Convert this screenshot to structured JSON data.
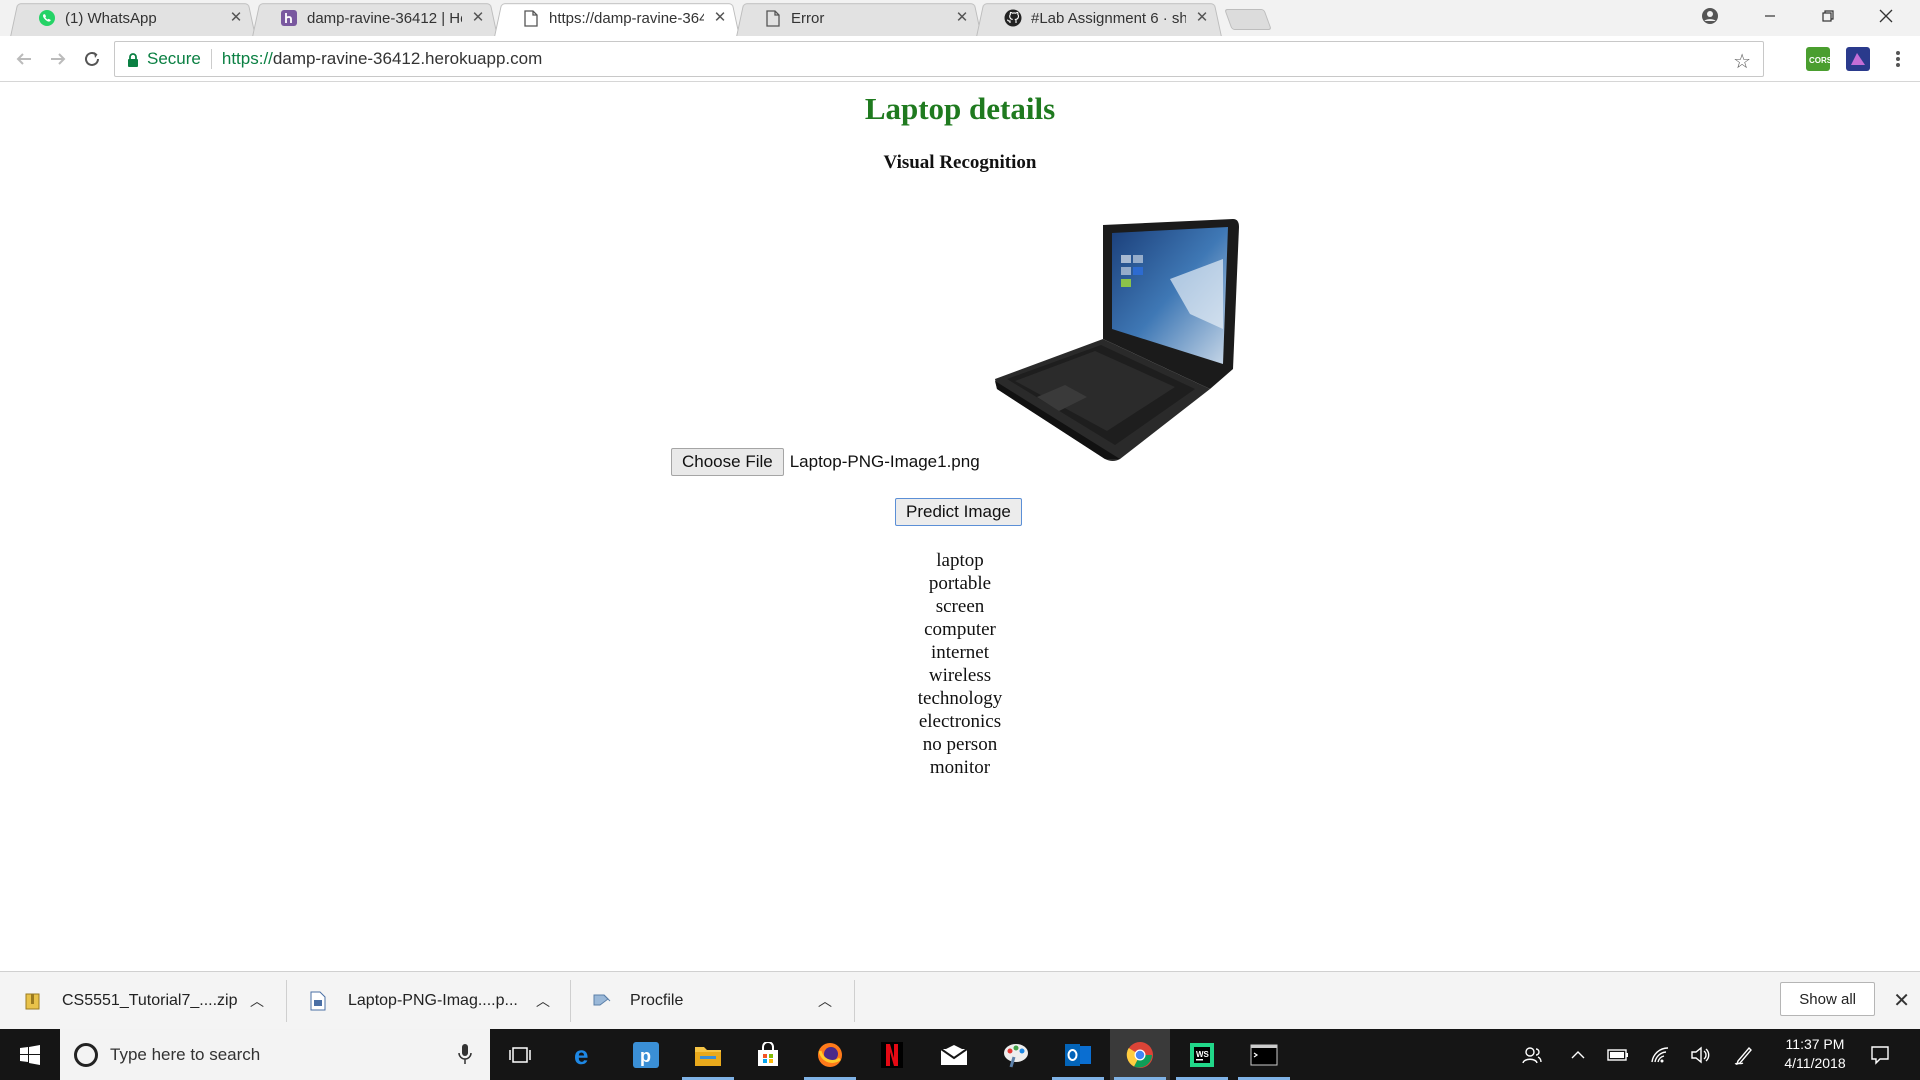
{
  "tabs": [
    {
      "title": "(1) WhatsApp",
      "icon": "whatsapp-icon"
    },
    {
      "title": "damp-ravine-36412 | Her",
      "icon": "heroku-icon"
    },
    {
      "title": "https://damp-ravine-364",
      "icon": "page-icon",
      "active": true
    },
    {
      "title": "Error",
      "icon": "page-icon"
    },
    {
      "title": "#Lab Assignment 6 · shar",
      "icon": "github-icon"
    }
  ],
  "omnibox": {
    "secure_label": "Secure",
    "url_protocol": "https://",
    "url_host": "damp-ravine-36412.herokuapp.com"
  },
  "page": {
    "title": "Laptop details",
    "subtitle": "Visual Recognition",
    "choose_file_label": "Choose File",
    "file_name": "Laptop-PNG-Image1.png",
    "predict_label": "Predict Image",
    "predictions": [
      "laptop",
      "portable",
      "screen",
      "computer",
      "internet",
      "wireless",
      "technology",
      "electronics",
      "no person",
      "monitor"
    ]
  },
  "downloads": [
    {
      "name": "CS5551_Tutorial7_....zip",
      "icon": "zip-file-icon"
    },
    {
      "name": "Laptop-PNG-Imag....p...",
      "icon": "image-file-icon"
    },
    {
      "name": "Procfile",
      "icon": "generic-file-icon"
    }
  ],
  "download_shelf": {
    "show_all_label": "Show all"
  },
  "taskbar": {
    "search_placeholder": "Type here to search",
    "time": "11:37 PM",
    "date": "4/11/2018"
  },
  "colors": {
    "title_green": "#1f7a1f",
    "secure_green": "#0b8043",
    "taskbar": "#151515"
  }
}
